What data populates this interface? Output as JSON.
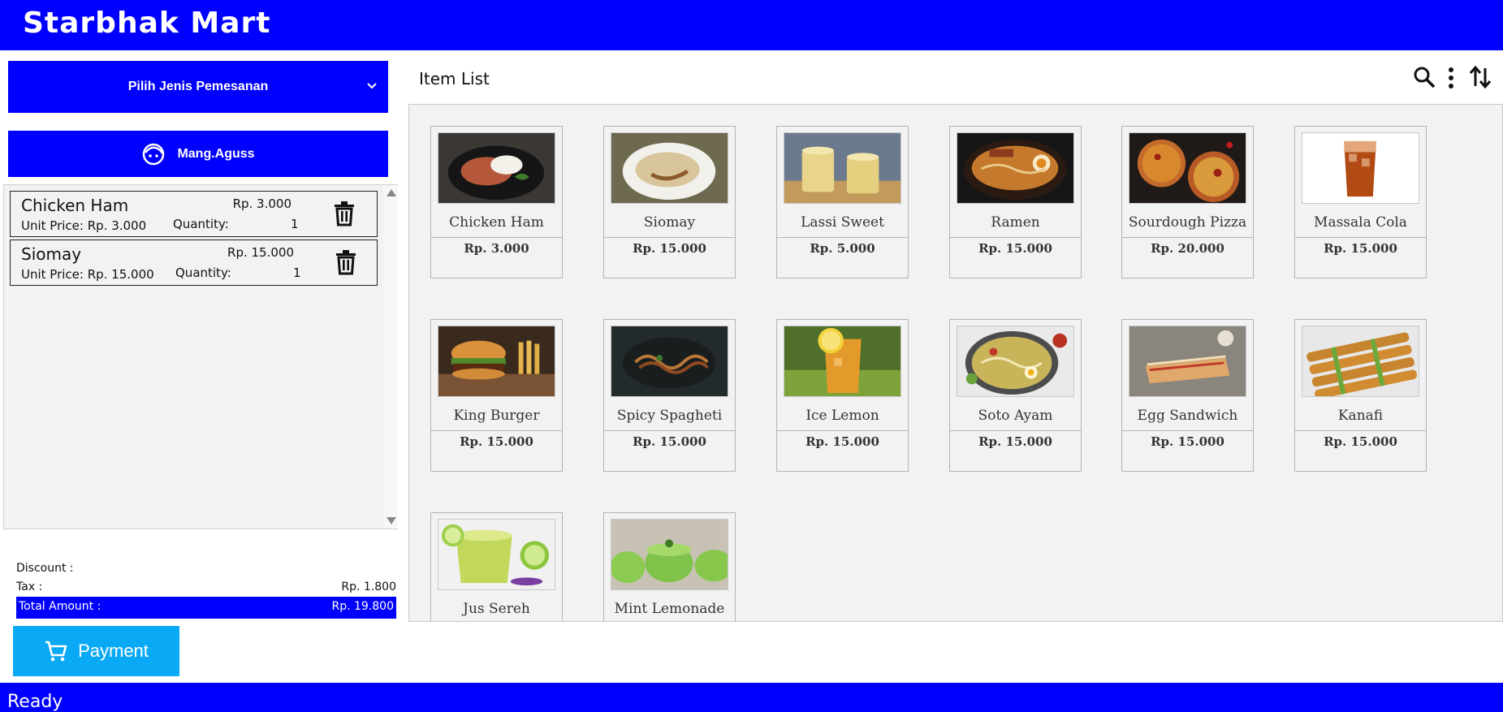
{
  "app": {
    "title": "Starbhak Mart"
  },
  "order_type": {
    "label": "Pilih Jenis Pemesanan"
  },
  "user": {
    "name": "Mang.Aguss"
  },
  "cart": {
    "items": [
      {
        "name": "Chicken Ham",
        "price": "Rp. 3.000",
        "unit_price": "Unit Price: Rp. 3.000",
        "qty_label": "Quantity:",
        "qty": "1"
      },
      {
        "name": "Siomay",
        "price": "Rp. 15.000",
        "unit_price": "Unit Price: Rp. 15.000",
        "qty_label": "Quantity:",
        "qty": "1"
      }
    ]
  },
  "summary": {
    "discount_label": "Discount :",
    "discount_value": "",
    "tax_label": "Tax :",
    "tax_value": "Rp. 1.800",
    "total_label": "Total Amount :",
    "total_value": "Rp. 19.800"
  },
  "payment": {
    "label": "Payment"
  },
  "status": {
    "text": "Ready"
  },
  "item_list": {
    "title": "Item List",
    "icons": [
      "search-icon",
      "more-vert-icon",
      "sort-icon"
    ],
    "products": [
      {
        "name": "Chicken Ham",
        "price": "Rp. 3.000",
        "img": "chicken"
      },
      {
        "name": "Siomay",
        "price": "Rp. 15.000",
        "img": "siomay"
      },
      {
        "name": "Lassi Sweet",
        "price": "Rp. 5.000",
        "img": "lassi"
      },
      {
        "name": "Ramen",
        "price": "Rp. 15.000",
        "img": "ramen"
      },
      {
        "name": "Sourdough Pizza",
        "price": "Rp. 20.000",
        "img": "pizza"
      },
      {
        "name": "Massala Cola",
        "price": "Rp. 15.000",
        "img": "cola"
      },
      {
        "name": "King Burger",
        "price": "Rp. 15.000",
        "img": "burger"
      },
      {
        "name": "Spicy Spagheti",
        "price": "Rp. 15.000",
        "img": "spaghetti"
      },
      {
        "name": "Ice Lemon",
        "price": "Rp. 15.000",
        "img": "icelemon"
      },
      {
        "name": "Soto Ayam",
        "price": "Rp. 15.000",
        "img": "soto"
      },
      {
        "name": "Egg Sandwich",
        "price": "Rp. 15.000",
        "img": "sandwich"
      },
      {
        "name": "Kanafi",
        "price": "Rp. 15.000",
        "img": "kanafi"
      },
      {
        "name": "Jus Sereh",
        "price": "",
        "img": "jussereh"
      },
      {
        "name": "Mint Lemonade",
        "price": "",
        "img": "mint"
      }
    ]
  },
  "colors": {
    "brand": "#0000FF",
    "payment": "#0AA9F5",
    "panel": "#F2F2F2"
  }
}
